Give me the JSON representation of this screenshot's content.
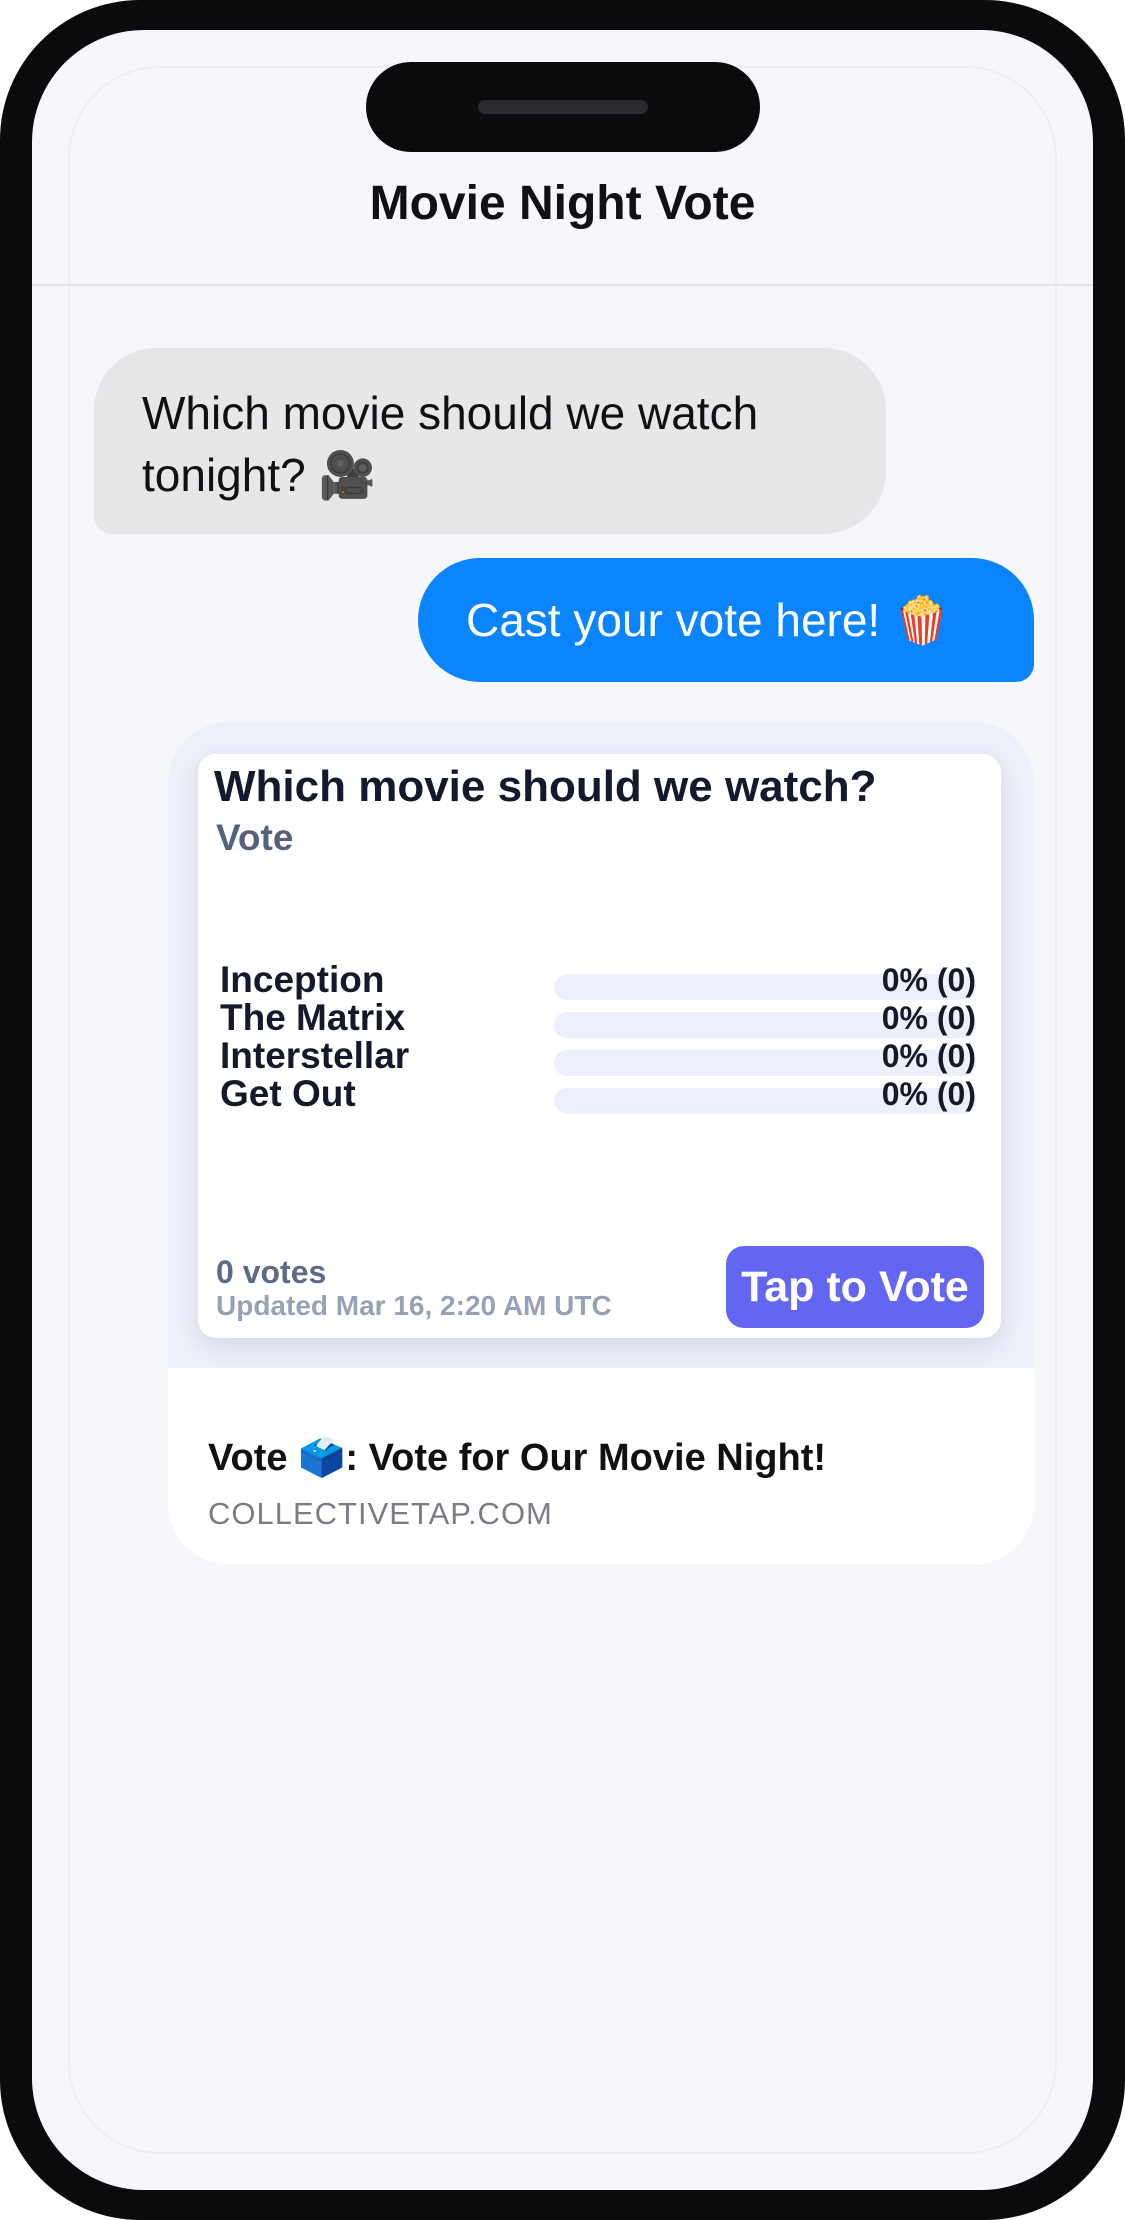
{
  "chat": {
    "title": "Movie Night Vote",
    "incoming_message": "Which movie should we watch tonight? 🎥",
    "outgoing_message": "Cast your vote here! 🍿"
  },
  "link_preview": {
    "poll": {
      "title": "Which movie should we watch?",
      "subtitle": "Vote",
      "options": [
        {
          "label": "Inception",
          "percent_text": "0% (0)",
          "fraction": 0
        },
        {
          "label": "The Matrix",
          "percent_text": "0% (0)",
          "fraction": 0
        },
        {
          "label": "Interstellar",
          "percent_text": "0% (0)",
          "fraction": 0
        },
        {
          "label": "Get Out",
          "percent_text": "0% (0)",
          "fraction": 0
        }
      ],
      "votes_count": "0 votes",
      "updated": "Updated Mar 16, 2:20 AM UTC",
      "vote_button_label": "Tap to Vote"
    },
    "link_title": "Vote 🗳️: Vote for Our Movie Night!",
    "domain": "COLLECTIVETAP.COM"
  },
  "colors": {
    "incoming_bubble": "#e7e7ea",
    "outgoing_bubble": "#0a84ff",
    "accent": "#6366f1",
    "bar_track": "#edf0fb"
  }
}
